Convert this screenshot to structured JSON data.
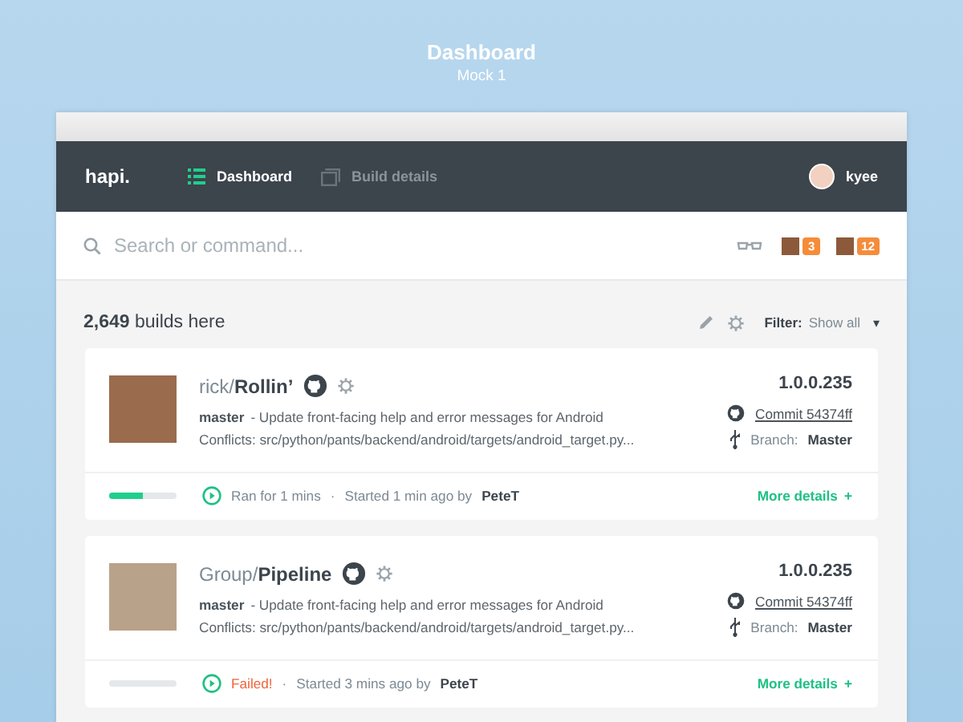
{
  "header": {
    "title": "Dashboard",
    "subtitle": "Mock 1"
  },
  "nav": {
    "logo": "hapi.",
    "tabs": [
      {
        "label": "Dashboard",
        "selected": true
      },
      {
        "label": "Build details",
        "selected": false
      }
    ],
    "user": "kyee"
  },
  "search": {
    "placeholder": "Search or command...",
    "badges": [
      "3",
      "12"
    ]
  },
  "summary": {
    "count": "2,649",
    "text": "builds here",
    "filter_label": "Filter:",
    "filter_value": "Show all",
    "caret": "▾"
  },
  "builds": [
    {
      "owner": "rick/",
      "repo": "Rollin’",
      "branch": "master",
      "message": "- Update front-facing help and error messages for Android",
      "conflicts": "Conflicts: src/python/pants/backend/android/targets/android_target.py...",
      "version": "1.0.0.235",
      "commit": "Commit 54374ff",
      "branch_label": "Branch:",
      "branch_value": "Master",
      "kind": "running",
      "level": 0.5,
      "status_text": "Ran for 1 mins",
      "separator": "·",
      "started": "Started 1 min ago by",
      "user": "PeteT",
      "details": "More details",
      "details_icon": "+"
    },
    {
      "owner": "Group/",
      "repo": "Pipeline",
      "branch": "master",
      "message": "- Update front-facing help and error messages for Android",
      "conflicts": "Conflicts: src/python/pants/backend/android/targets/android_target.py...",
      "version": "1.0.0.235",
      "commit": "Commit 54374ff",
      "branch_label": "Branch:",
      "branch_value": "Master",
      "kind": "failed",
      "level": 0,
      "status_text": "Failed!",
      "separator": "·",
      "started": "Started 3 mins ago by",
      "user": "PeteT",
      "details": "More details",
      "details_icon": "+"
    }
  ]
}
